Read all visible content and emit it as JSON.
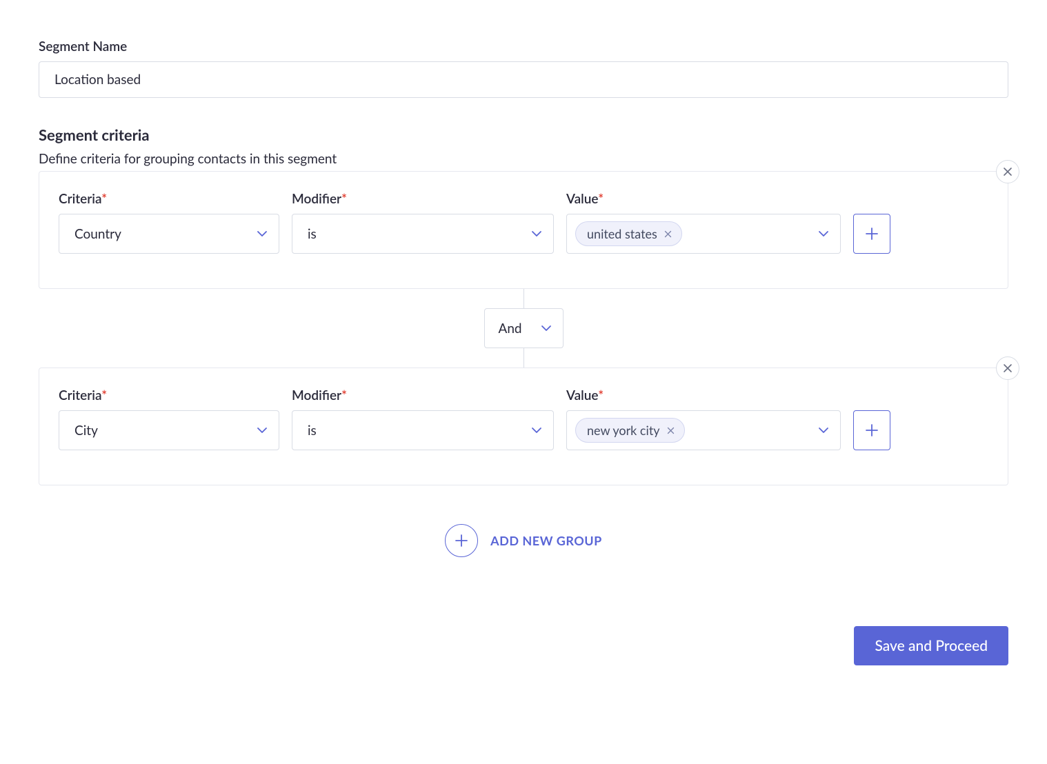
{
  "segment_name": {
    "label": "Segment Name",
    "value": "Location based"
  },
  "criteria": {
    "heading": "Segment criteria",
    "subheading": "Define criteria for grouping contacts in this segment",
    "labels": {
      "criteria": "Criteria",
      "modifier": "Modifier",
      "value": "Value",
      "required": "*"
    },
    "groups": [
      {
        "criteria_value": "Country",
        "modifier_value": "is",
        "value_chip": "united states"
      },
      {
        "criteria_value": "City",
        "modifier_value": "is",
        "value_chip": "new york city"
      }
    ],
    "connector": "And"
  },
  "add_group_label": "ADD NEW GROUP",
  "footer": {
    "save_button": "Save and Proceed"
  }
}
